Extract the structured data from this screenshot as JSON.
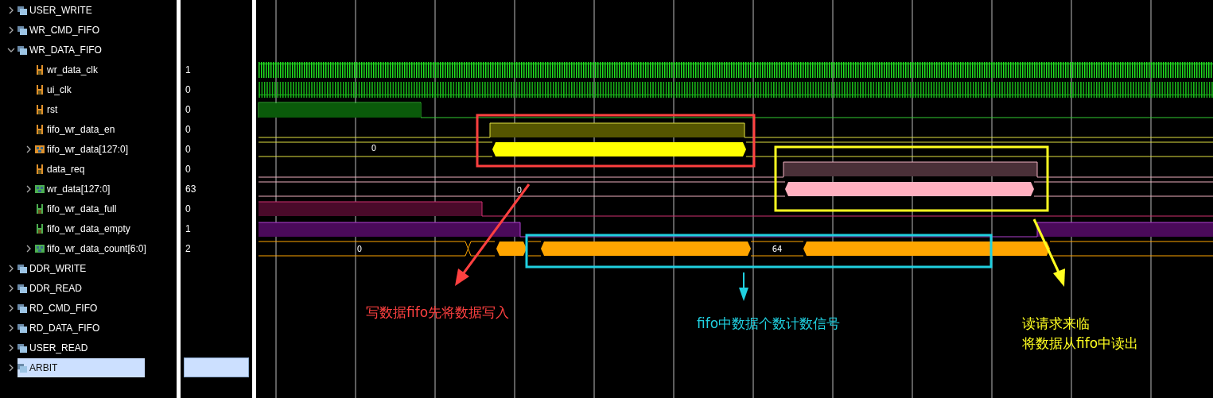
{
  "tree": [
    {
      "kind": "group",
      "label": "USER_WRITE",
      "expanded": false,
      "selected": false
    },
    {
      "kind": "group",
      "label": "WR_CMD_FIFO",
      "expanded": false,
      "selected": false
    },
    {
      "kind": "group",
      "label": "WR_DATA_FIFO",
      "expanded": true,
      "selected": false,
      "children": [
        {
          "kind": "wire",
          "label": "wr_data_clk",
          "value": "1",
          "color": "#e0902a",
          "selected": false
        },
        {
          "kind": "wire",
          "label": "ui_clk",
          "value": "0",
          "color": "#e0902a",
          "selected": false
        },
        {
          "kind": "wire",
          "label": "rst",
          "value": "0",
          "color": "#e0902a",
          "selected": false
        },
        {
          "kind": "wire",
          "label": "fifo_wr_data_en",
          "value": "0",
          "color": "#e0902a",
          "selected": false
        },
        {
          "kind": "bus",
          "label": "fifo_wr_data[127:0]",
          "value": "0",
          "color": "#e0902a",
          "expanded": false,
          "selected": false,
          "wave_labels": [
            "0"
          ]
        },
        {
          "kind": "wire",
          "label": "data_req",
          "value": "0",
          "color": "#e0902a",
          "selected": false
        },
        {
          "kind": "bus",
          "label": "wr_data[127:0]",
          "value": "63",
          "color": "#4caf50",
          "expanded": false,
          "selected": false,
          "wave_labels": [
            "0"
          ]
        },
        {
          "kind": "wire",
          "label": "fifo_wr_data_full",
          "value": "0",
          "color": "#4caf50",
          "selected": false
        },
        {
          "kind": "wire",
          "label": "fifo_wr_data_empty",
          "value": "1",
          "color": "#4caf50",
          "selected": false
        },
        {
          "kind": "bus",
          "label": "fifo_wr_data_count[6:0]",
          "value": "2",
          "color": "#4caf50",
          "expanded": false,
          "selected": false,
          "wave_labels": [
            "0",
            "64"
          ]
        }
      ]
    },
    {
      "kind": "group",
      "label": "DDR_WRITE",
      "expanded": false,
      "selected": false
    },
    {
      "kind": "group",
      "label": "DDR_READ",
      "expanded": false,
      "selected": false
    },
    {
      "kind": "group",
      "label": "RD_CMD_FIFO",
      "expanded": false,
      "selected": false
    },
    {
      "kind": "group",
      "label": "RD_DATA_FIFO",
      "expanded": false,
      "selected": false
    },
    {
      "kind": "group",
      "label": "USER_READ",
      "expanded": false,
      "selected": false
    },
    {
      "kind": "group",
      "label": "ARBIT",
      "expanded": false,
      "selected": true
    }
  ],
  "annotations": [
    {
      "kind": "write",
      "color": "#ff4040",
      "lines": [
        "写数据fifo先将数据写入"
      ]
    },
    {
      "kind": "count",
      "color": "#20d0e0",
      "lines": [
        "fifo中数据个数计数信号"
      ]
    },
    {
      "kind": "read",
      "color": "#ffff20",
      "lines": [
        "读请求来临",
        "将数据从fifo中读出"
      ]
    }
  ]
}
